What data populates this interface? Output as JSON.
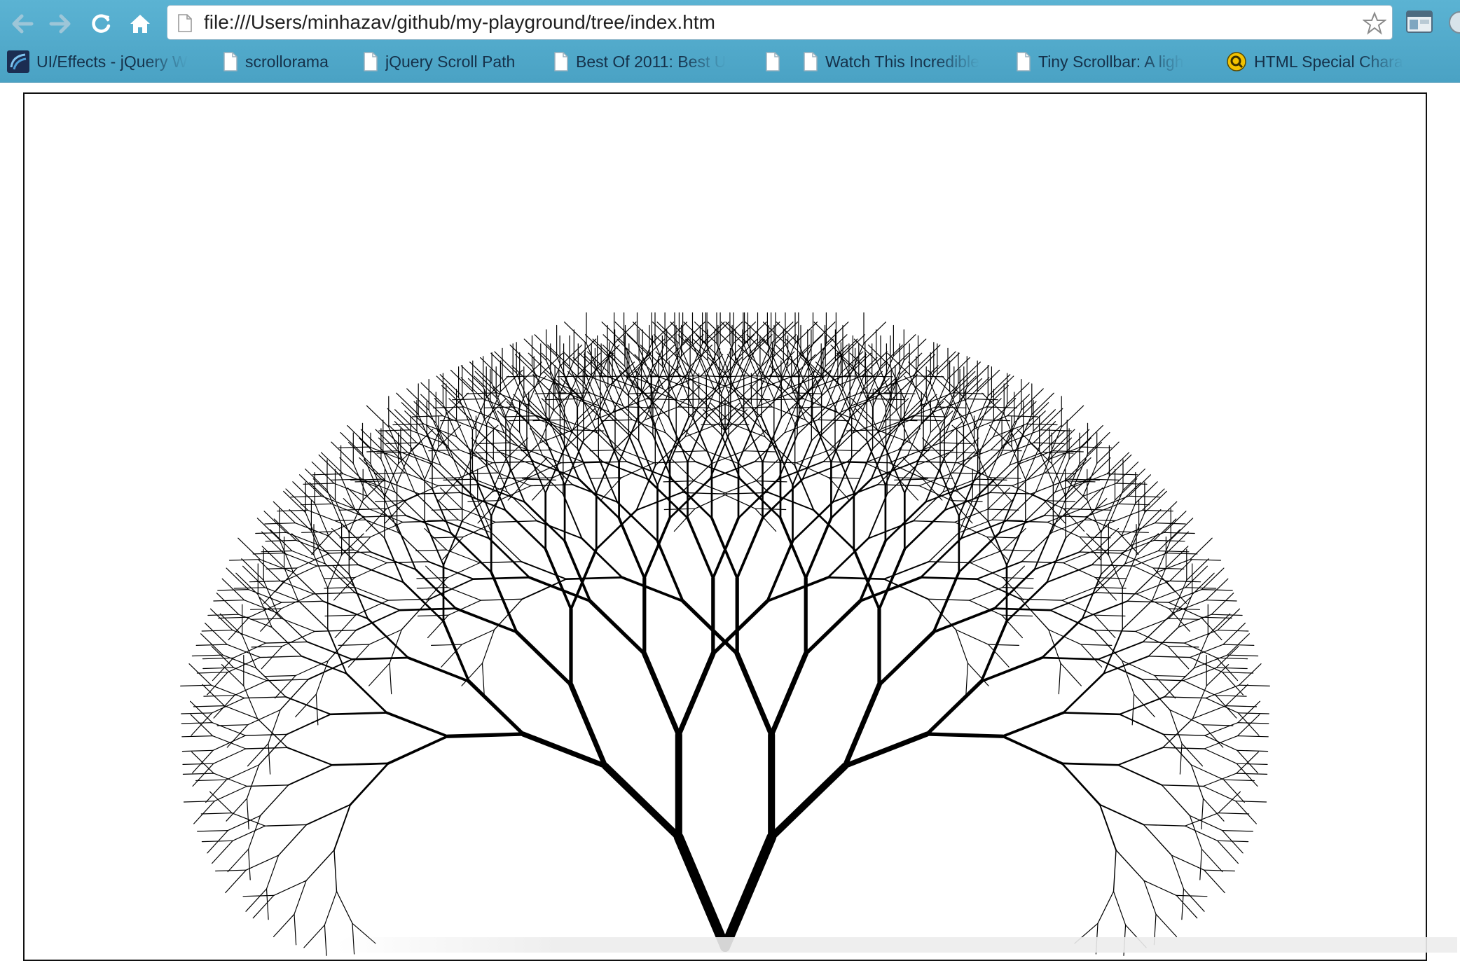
{
  "browser": {
    "url": "file:///Users/minhazav/github/my-playground/tree/index.htm",
    "icons": [
      "back-arrow-icon",
      "forward-arrow-icon",
      "reload-icon",
      "home-icon",
      "page-icon",
      "star-icon",
      "extension-icon"
    ],
    "colors": {
      "toolbar": "#52abcc",
      "bookmark_text": "#15314a"
    }
  },
  "bookmarks": [
    {
      "label": "UI/Effects - jQuery W",
      "icon": "jquery-ui-icon"
    },
    {
      "label": "scrollorama",
      "icon": "page-icon"
    },
    {
      "label": "jQuery Scroll Path",
      "icon": "page-icon"
    },
    {
      "label": "Best Of 2011: Best U",
      "icon": "page-icon"
    },
    {
      "label": "",
      "icon": "page-icon"
    },
    {
      "label": "Watch This Incredible",
      "icon": "page-icon"
    },
    {
      "label": "Tiny Scrollbar: A ligh",
      "icon": "page-icon"
    },
    {
      "label": "HTML Special Chara",
      "icon": "search-q-icon"
    }
  ],
  "canvas": {
    "content": "fractal-tree",
    "stroke_color": "#000000"
  }
}
